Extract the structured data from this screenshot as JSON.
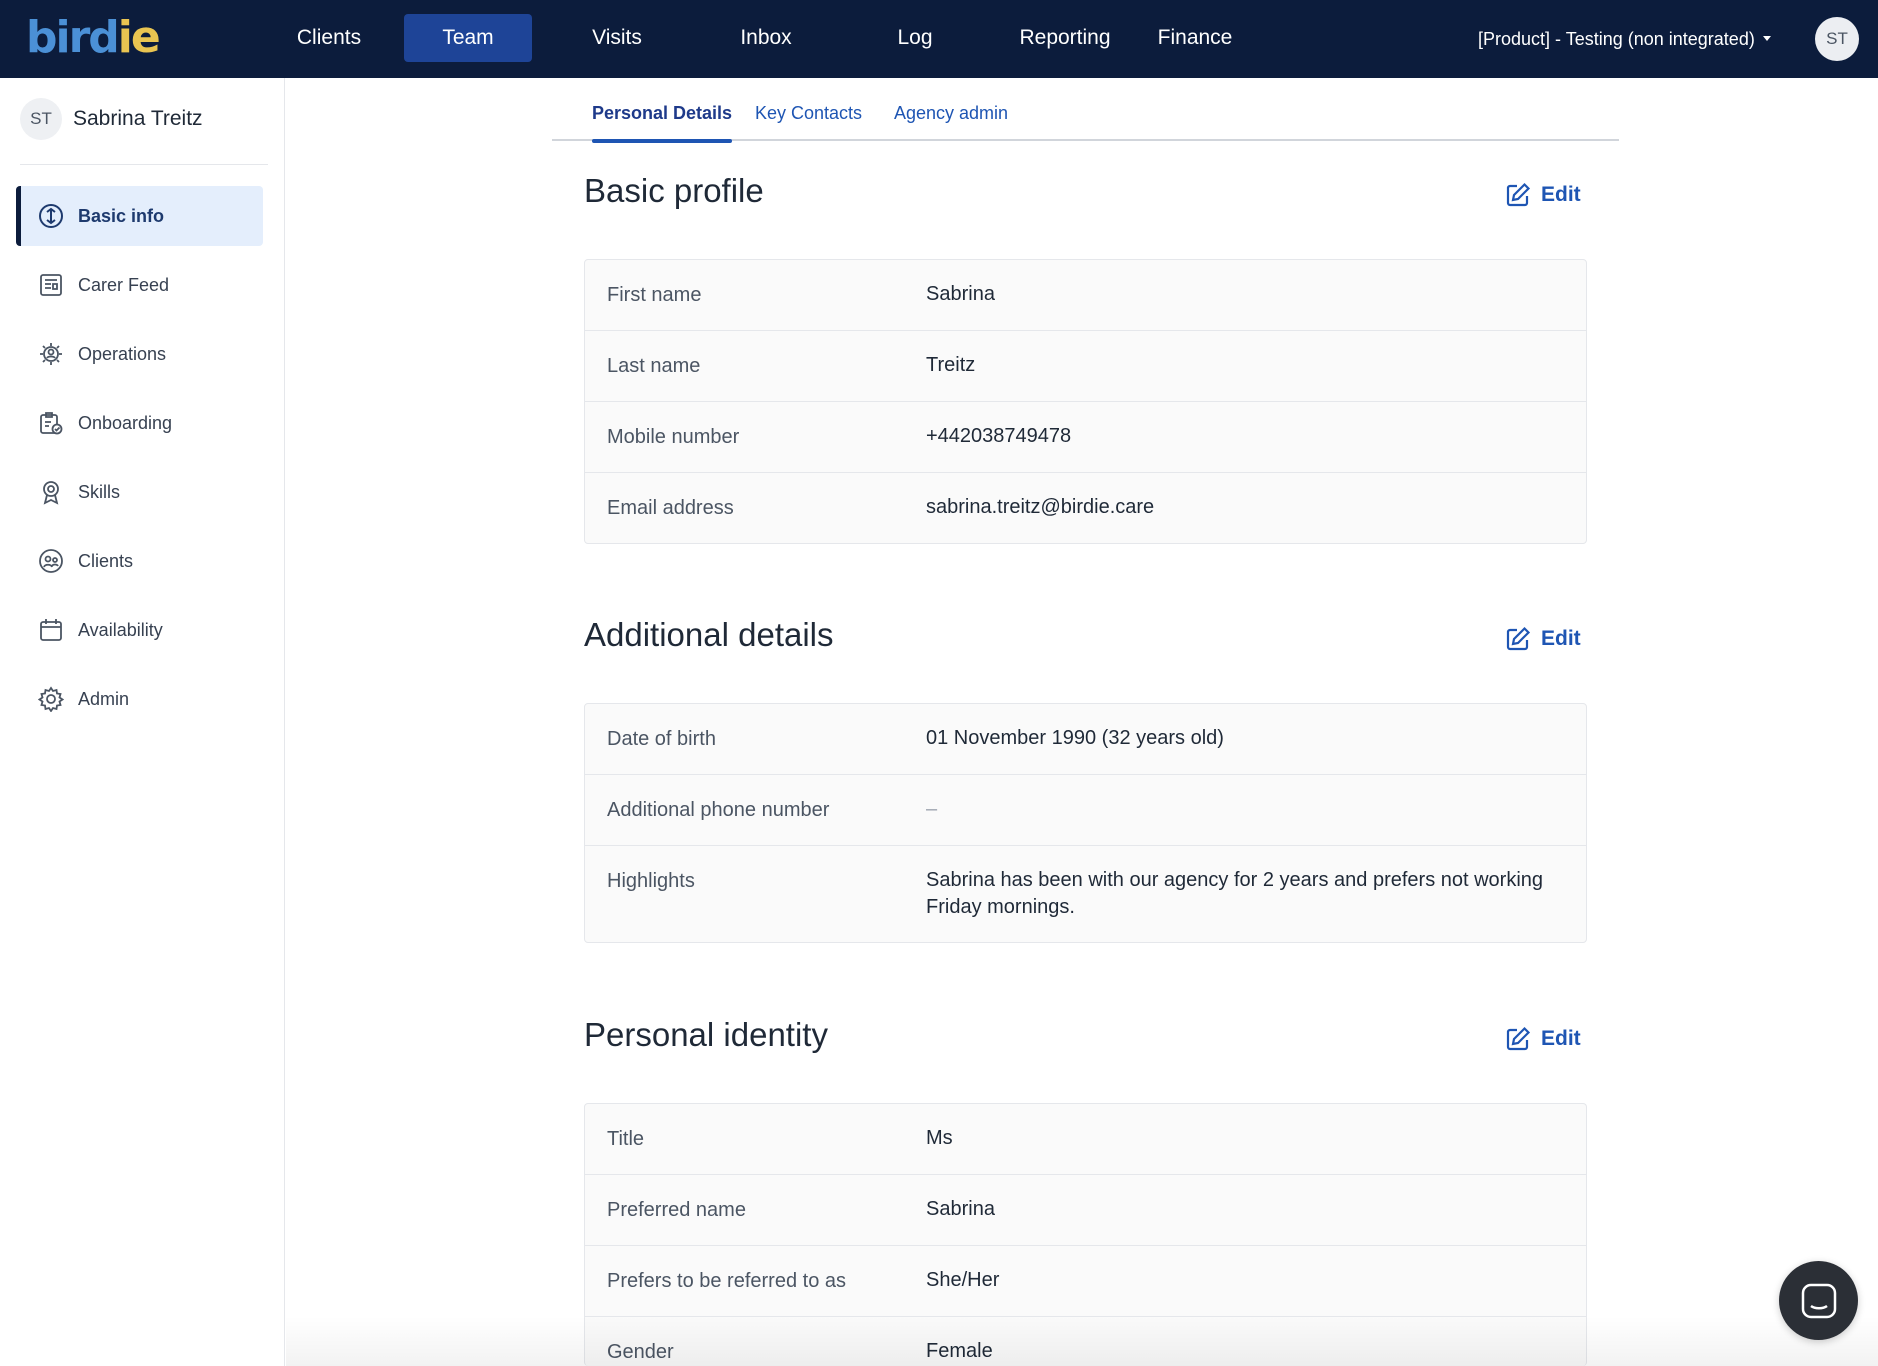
{
  "app": {
    "logo_main": "bird",
    "logo_accent": "ie",
    "nav": [
      {
        "label": "Clients",
        "active": false
      },
      {
        "label": "Team",
        "active": true
      },
      {
        "label": "Visits",
        "active": false
      },
      {
        "label": "Inbox",
        "active": false
      },
      {
        "label": "Log",
        "active": false
      },
      {
        "label": "Reporting",
        "active": false
      },
      {
        "label": "Finance",
        "active": false
      }
    ],
    "agency_selector": "[Product] - Testing (non integrated)",
    "user_initials": "ST"
  },
  "sidebar": {
    "user_initials": "ST",
    "user_name": "Sabrina Treitz",
    "items": [
      {
        "label": "Basic info",
        "icon": "basic-info-icon",
        "active": true
      },
      {
        "label": "Carer Feed",
        "icon": "feed-icon",
        "active": false
      },
      {
        "label": "Operations",
        "icon": "operations-icon",
        "active": false
      },
      {
        "label": "Onboarding",
        "icon": "onboarding-icon",
        "active": false
      },
      {
        "label": "Skills",
        "icon": "skills-icon",
        "active": false
      },
      {
        "label": "Clients",
        "icon": "clients-icon",
        "active": false
      },
      {
        "label": "Availability",
        "icon": "calendar-icon",
        "active": false
      },
      {
        "label": "Admin",
        "icon": "gear-icon",
        "active": false
      }
    ]
  },
  "tabs": [
    {
      "label": "Personal Details",
      "active": true
    },
    {
      "label": "Key Contacts",
      "active": false
    },
    {
      "label": "Agency admin",
      "active": false
    }
  ],
  "sections": {
    "basic_profile": {
      "title": "Basic profile",
      "edit_label": "Edit",
      "rows": [
        {
          "label": "First name",
          "value": "Sabrina"
        },
        {
          "label": "Last name",
          "value": "Treitz"
        },
        {
          "label": "Mobile number",
          "value": "+442038749478"
        },
        {
          "label": "Email address",
          "value": "sabrina.treitz@birdie.care"
        }
      ]
    },
    "additional_details": {
      "title": "Additional details",
      "edit_label": "Edit",
      "rows": [
        {
          "label": "Date of birth",
          "value": "01 November 1990 (32 years old)"
        },
        {
          "label": "Additional phone number",
          "value": "–"
        },
        {
          "label": "Highlights",
          "value": "Sabrina has been with our agency for 2 years and prefers not working Friday mornings."
        }
      ]
    },
    "personal_identity": {
      "title": "Personal identity",
      "edit_label": "Edit",
      "rows": [
        {
          "label": "Title",
          "value": "Ms"
        },
        {
          "label": "Preferred name",
          "value": "Sabrina"
        },
        {
          "label": "Prefers to be referred to as",
          "value": "She/Her"
        },
        {
          "label": "Gender",
          "value": "Female"
        }
      ]
    }
  },
  "colors": {
    "nav_bg": "#0c1c3c",
    "nav_active": "#1e4497",
    "link_blue": "#1e55b3",
    "sidebar_active_bg": "#e4eefc"
  }
}
